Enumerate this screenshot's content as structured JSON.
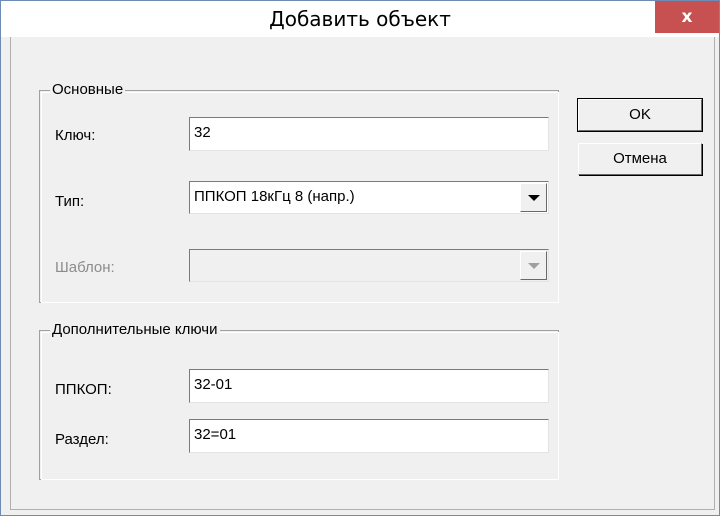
{
  "window": {
    "title": "Добавить объект",
    "close_label": "x"
  },
  "main_group": {
    "legend": "Основные",
    "key_label": "Ключ:",
    "key_value": "32",
    "type_label": "Тип:",
    "type_value": "ППКОП 18кГц  8 (напр.)",
    "template_label": "Шаблон:",
    "template_value": ""
  },
  "extra_group": {
    "legend": "Дополнительные ключи",
    "ppkop_label": "ППКОП:",
    "ppkop_value": "32-01",
    "section_label": "Раздел:",
    "section_value": "32=01"
  },
  "buttons": {
    "ok_label": "OK",
    "cancel_label": "Отмена"
  }
}
